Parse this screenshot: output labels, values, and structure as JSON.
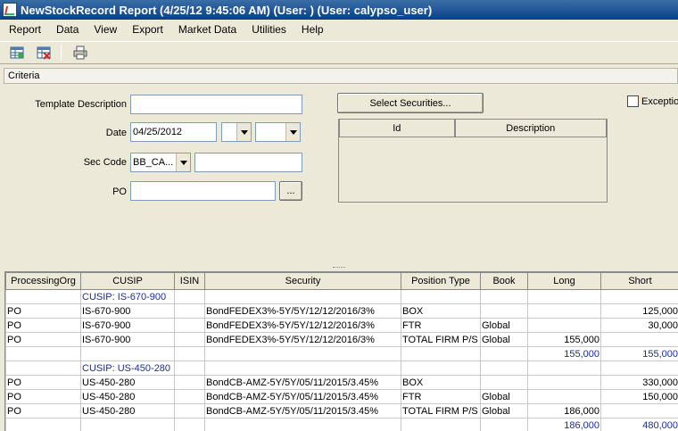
{
  "window": {
    "title": "NewStockRecord Report (4/25/12 9:45:06 AM) (User: ) (User: calypso_user)"
  },
  "menu": [
    "Report",
    "Data",
    "View",
    "Export",
    "Market Data",
    "Utilities",
    "Help"
  ],
  "toolbar": {
    "icons": [
      "load-template-icon",
      "delete-template-icon",
      "print-icon"
    ]
  },
  "criteria": {
    "header": "Criteria",
    "template_description_label": "Template Description",
    "template_description_value": "",
    "date_label": "Date",
    "date_value": "04/25/2012",
    "sec_code_label": "Sec Code",
    "sec_code_value": "BB_CA...",
    "sec_code_text": "",
    "po_label": "PO",
    "po_value": "",
    "po_button": "...",
    "select_securities_button": "Select Securities...",
    "securities_columns": [
      "Id",
      "Description"
    ],
    "exception_label": "Exception"
  },
  "table": {
    "columns": [
      "ProcessingOrg",
      "CUSIP",
      "ISIN",
      "Security",
      "Position Type",
      "Book",
      "Long",
      "Short"
    ],
    "rows": [
      {
        "type": "group",
        "cells": [
          "",
          "CUSIP: IS-670-900",
          "",
          "",
          "",
          "",
          "",
          ""
        ]
      },
      {
        "type": "data",
        "cells": [
          "PO",
          "IS-670-900",
          "",
          "BondFEDEX3%-5Y/5Y/12/12/2016/3%",
          "BOX",
          "",
          "",
          "125,000"
        ]
      },
      {
        "type": "data",
        "cells": [
          "PO",
          "IS-670-900",
          "",
          "BondFEDEX3%-5Y/5Y/12/12/2016/3%",
          "FTR",
          "Global",
          "",
          "30,000"
        ]
      },
      {
        "type": "data",
        "cells": [
          "PO",
          "IS-670-900",
          "",
          "BondFEDEX3%-5Y/5Y/12/12/2016/3%",
          "TOTAL FIRM P/S",
          "Global",
          "155,000",
          ""
        ]
      },
      {
        "type": "sum",
        "cells": [
          "",
          "",
          "",
          "",
          "",
          "",
          "155,000",
          "155,000"
        ]
      },
      {
        "type": "group",
        "cells": [
          "",
          "CUSIP: US-450-280",
          "",
          "",
          "",
          "",
          "",
          ""
        ]
      },
      {
        "type": "data",
        "cells": [
          "PO",
          "US-450-280",
          "",
          "BondCB-AMZ-5Y/5Y/05/11/2015/3.45%",
          "BOX",
          "",
          "",
          "330,000"
        ]
      },
      {
        "type": "data",
        "cells": [
          "PO",
          "US-450-280",
          "",
          "BondCB-AMZ-5Y/5Y/05/11/2015/3.45%",
          "FTR",
          "Global",
          "",
          "150,000"
        ]
      },
      {
        "type": "data",
        "cells": [
          "PO",
          "US-450-280",
          "",
          "BondCB-AMZ-5Y/5Y/05/11/2015/3.45%",
          "TOTAL FIRM P/S",
          "Global",
          "186,000",
          ""
        ]
      },
      {
        "type": "sum",
        "cells": [
          "",
          "",
          "",
          "",
          "",
          "",
          "186,000",
          "480,000"
        ]
      }
    ]
  }
}
